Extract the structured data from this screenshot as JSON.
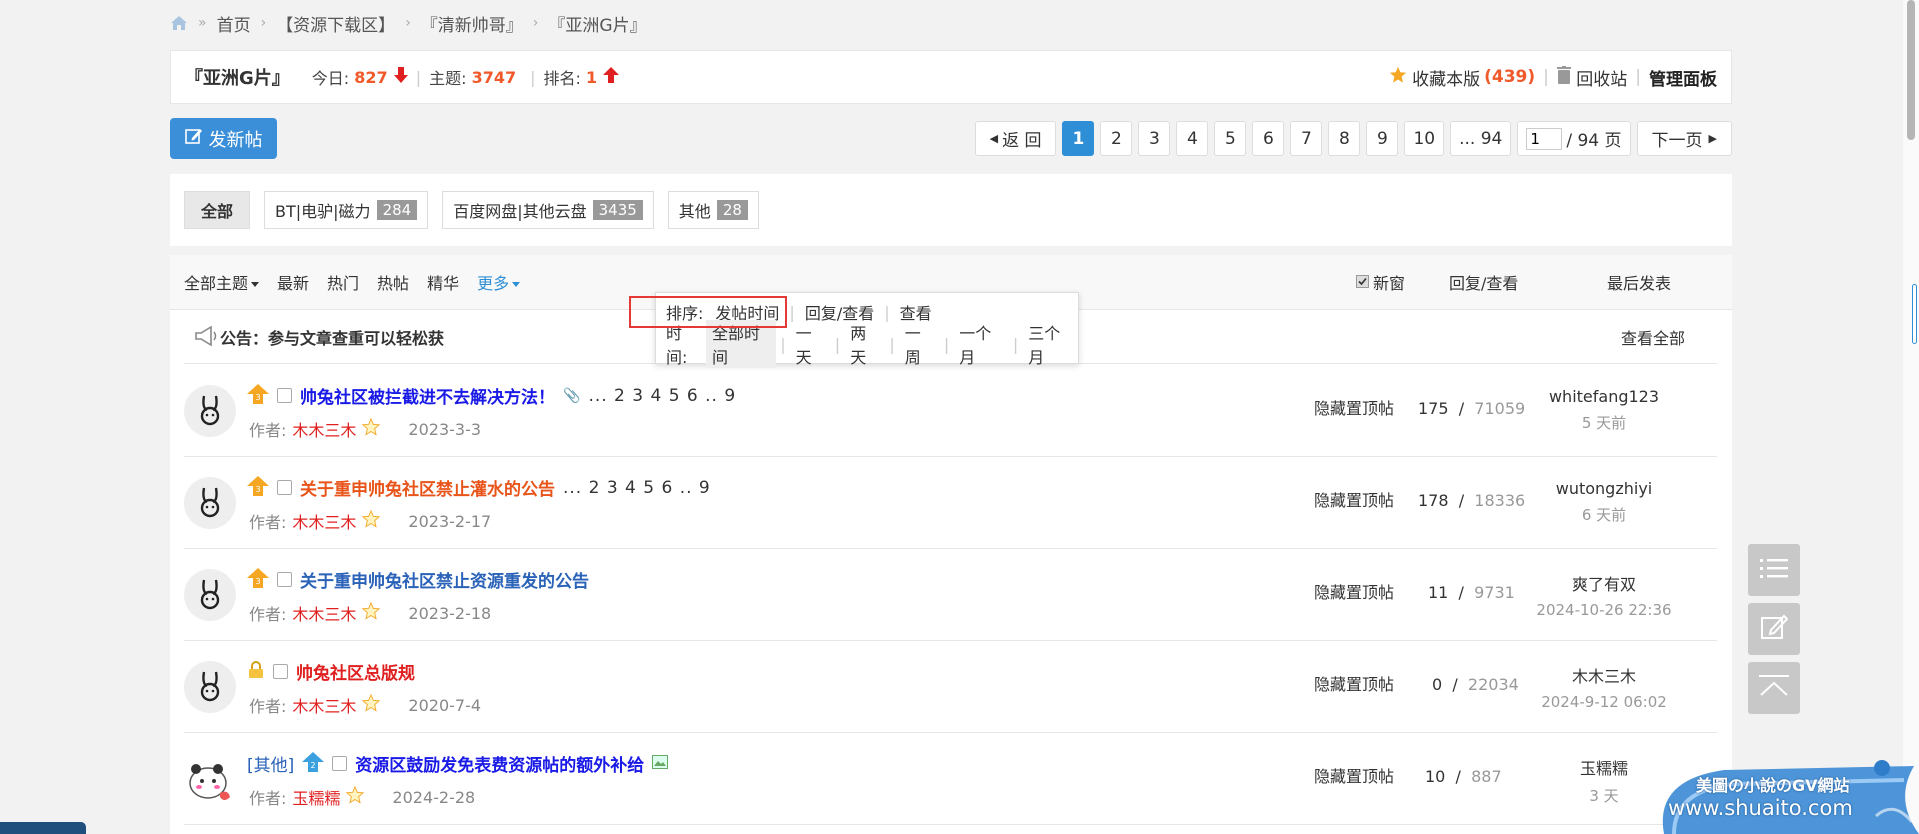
{
  "breadcrumb": {
    "items": [
      "首页",
      "【资源下载区】",
      "『清新帅哥』",
      "『亚洲G片』"
    ],
    "sep": "»"
  },
  "forum": {
    "name": "『亚洲G片』",
    "today_label": "今日:",
    "today": "827",
    "topics_label": "主题:",
    "topics": "3747",
    "rank_label": "排名:",
    "rank": "1",
    "fav_label": "收藏本版",
    "fav_count": "(439)",
    "recycle_label": "回收站",
    "admin_label": "管理面板"
  },
  "post_button": "发新帖",
  "pager": {
    "back": "返 回",
    "pages": [
      "1",
      "2",
      "3",
      "4",
      "5",
      "6",
      "7",
      "8",
      "9",
      "10"
    ],
    "ellipsis": "... 94",
    "jump_value": "1",
    "total": "/ 94 页",
    "next": "下一页"
  },
  "categories": [
    {
      "label": "全部",
      "count": ""
    },
    {
      "label": "BT|电驴|磁力",
      "count": "284"
    },
    {
      "label": "百度网盘|其他云盘",
      "count": "3435"
    },
    {
      "label": "其他",
      "count": "28"
    }
  ],
  "toolbar": {
    "all": "全部主题",
    "items": [
      "最新",
      "热门",
      "热帖",
      "精华"
    ],
    "more": "更多",
    "new_window": "新窗",
    "col_replies": "回复/查看",
    "col_last": "最后发表"
  },
  "dropdown": {
    "sort_label": "排序:",
    "sort_opts": [
      "发帖时间",
      "回复/查看",
      "查看"
    ],
    "time_label": "时间:",
    "time_opts": [
      "全部时间",
      "一天",
      "两天",
      "一周",
      "一个月",
      "三个月"
    ]
  },
  "announcement": {
    "text": "公告：参与文章查重可以轻松获",
    "view_all": "查看全部"
  },
  "threads": [
    {
      "tag": "",
      "title": "帅兔社区被拦截进不去解决方法！",
      "title_color": "#1a1ae6",
      "pages": "... 2  3  4  5  6 .. 9",
      "author_label": "作者:",
      "author": "木木三木",
      "date": "2023-3-3",
      "hide": "隐藏置顶帖",
      "replies": "175",
      "views": "71059",
      "last_user": "whitefang123",
      "last_time": "5 天前",
      "pin_icon": "pin-level-3-icon"
    },
    {
      "tag": "",
      "title": "关于重申帅兔社区禁止灌水的公告",
      "title_color": "#e8541a",
      "pages": "... 2  3  4  5  6 .. 9",
      "author_label": "作者:",
      "author": "木木三木",
      "date": "2023-2-17",
      "hide": "隐藏置顶帖",
      "replies": "178",
      "views": "18336",
      "last_user": "wutongzhiyi",
      "last_time": "6 天前",
      "pin_icon": "pin-level-3-icon"
    },
    {
      "tag": "",
      "title": "关于重申帅兔社区禁止资源重发的公告",
      "title_color": "#2a62b8",
      "pages": "",
      "author_label": "作者:",
      "author": "木木三木",
      "date": "2023-2-18",
      "hide": "隐藏置顶帖",
      "replies": "11",
      "views": "9731",
      "last_user": "爽了有双",
      "last_time": "2024-10-26 22:36",
      "pin_icon": "pin-level-3-icon"
    },
    {
      "tag": "",
      "title": "帅兔社区总版规",
      "title_color": "#e02020",
      "pages": "",
      "author_label": "作者:",
      "author": "木木三木",
      "date": "2020-7-4",
      "hide": "隐藏置顶帖",
      "replies": "0",
      "views": "22034",
      "last_user": "木木三木",
      "last_time": "2024-9-12 06:02",
      "pin_icon": "lock-icon"
    },
    {
      "tag": "[其他]",
      "title": "资源区鼓励发免表费资源帖的额外补给",
      "title_color": "#1a1ae6",
      "pages": "",
      "author_label": "作者:",
      "author": "玉糯糯",
      "date": "2024-2-28",
      "hide": "隐藏置顶帖",
      "replies": "10",
      "views": "887",
      "last_user": "玉糯糯",
      "last_time": "3 天",
      "pin_icon": "pin-level-2-icon"
    }
  ],
  "watermark": {
    "line1": "美圖の小說のGV網站",
    "line2": "www.shuaito.com"
  },
  "colors": {
    "accent": "#2f8fd6",
    "orange": "#f0592a",
    "red": "#e02020",
    "highlight_box": "#e53935"
  }
}
